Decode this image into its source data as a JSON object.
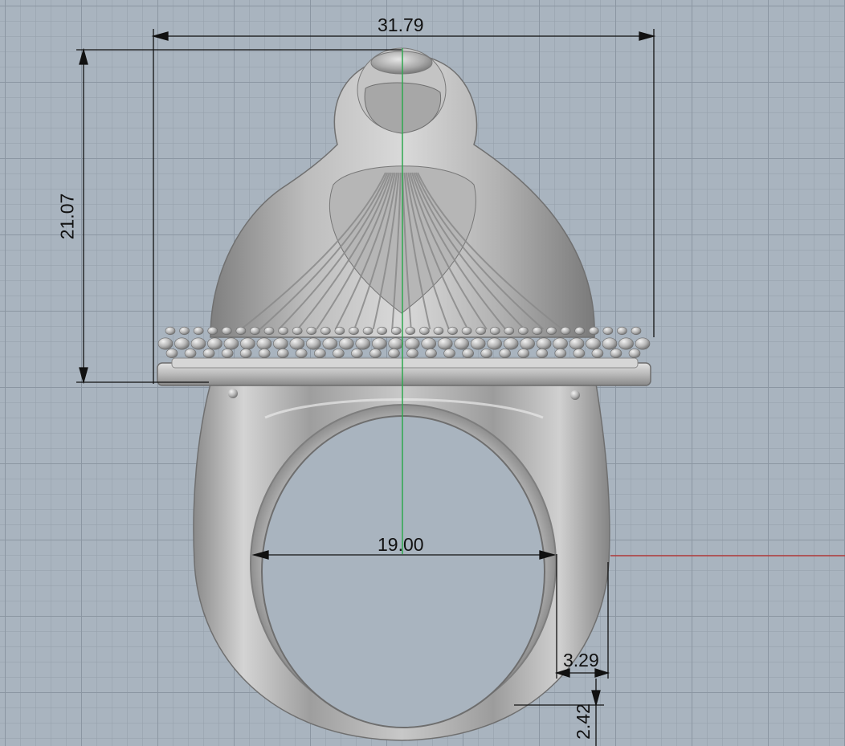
{
  "viewport": {
    "name": "Front",
    "colors": {
      "background": "#a9b4bf",
      "grid_minor": "#96a0ab",
      "grid_major": "#8a95a1",
      "x_axis": "#b03a3a",
      "y_axis": "#2fa84f",
      "dimension": "#111111",
      "ring_metal": "#b8b8b8"
    }
  },
  "dimensions": {
    "top_width": "31.79",
    "head_height": "21.07",
    "inner_diameter": "19.00",
    "shank_width": "3.29",
    "shank_thickness": "2.42"
  }
}
